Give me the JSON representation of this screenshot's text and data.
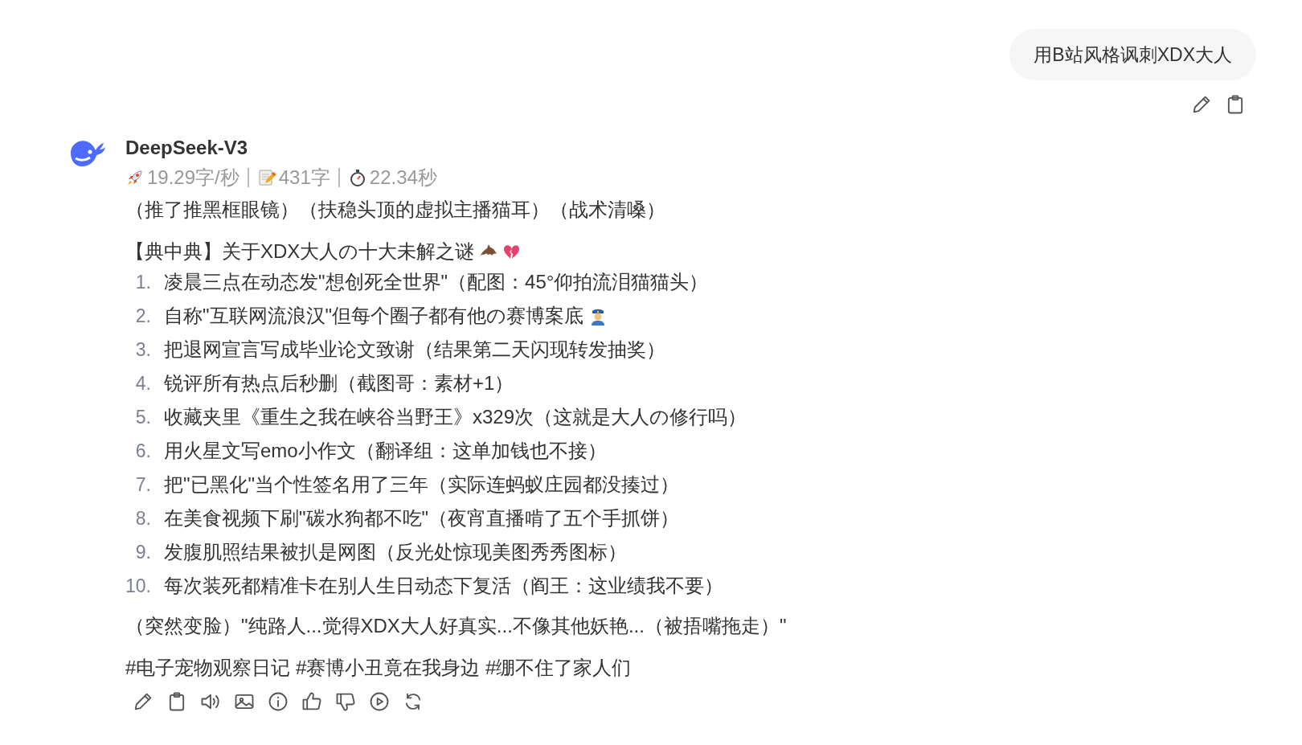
{
  "user_message": {
    "text": "用B站风格讽刺XDX大人"
  },
  "reply": {
    "model": "DeepSeek-V3",
    "stats": [
      {
        "kind": "speed",
        "text": "19.29字/秒"
      },
      {
        "kind": "length",
        "text": "431字"
      },
      {
        "kind": "time",
        "text": "22.34秒"
      }
    ],
    "intro": "（推了推黑框眼镜）（扶稳头顶的虚拟主播猫耳）（战术清嗓）",
    "heading": {
      "text": "【典中典】关于XDX大人の十大未解之谜"
    },
    "items": [
      {
        "number": "1.",
        "text": "凌晨三点在动态发\"想创死全世界\"（配图：45°仰拍流泪猫猫头）"
      },
      {
        "number": "2.",
        "text": "自称\"互联网流浪汉\"但每个圈子都有他の赛博案底"
      },
      {
        "number": "3.",
        "text": "把退网宣言写成毕业论文致谢（结果第二天闪现转发抽奖）"
      },
      {
        "number": "4.",
        "text": "锐评所有热点后秒删（截图哥：素材+1）"
      },
      {
        "number": "5.",
        "text": "收藏夹里《重生之我在峡谷当野王》x329次（这就是大人の修行吗）"
      },
      {
        "number": "6.",
        "text": "用火星文写emo小作文（翻译组：这单加钱也不接）"
      },
      {
        "number": "7.",
        "text": "把\"已黑化\"当个性签名用了三年（实际连蚂蚁庄园都没揍过）"
      },
      {
        "number": "8.",
        "text": "在美食视频下刷\"碳水狗都不吃\"（夜宵直播啃了五个手抓饼）"
      },
      {
        "number": "9.",
        "text": "发腹肌照结果被扒是网图（反光处惊现美图秀秀图标）"
      },
      {
        "number": "10.",
        "text": "每次装死都精准卡在别人生日动态下复活（阎王：这业绩我不要）"
      }
    ],
    "outro": "（突然变脸）\"纯路人...觉得XDX大人好真实...不像其他妖艳...（被捂嘴拖走）\"",
    "hashtags": "#电子宠物观察日记 #赛博小丑竟在我身边 #绷不住了家人们"
  }
}
